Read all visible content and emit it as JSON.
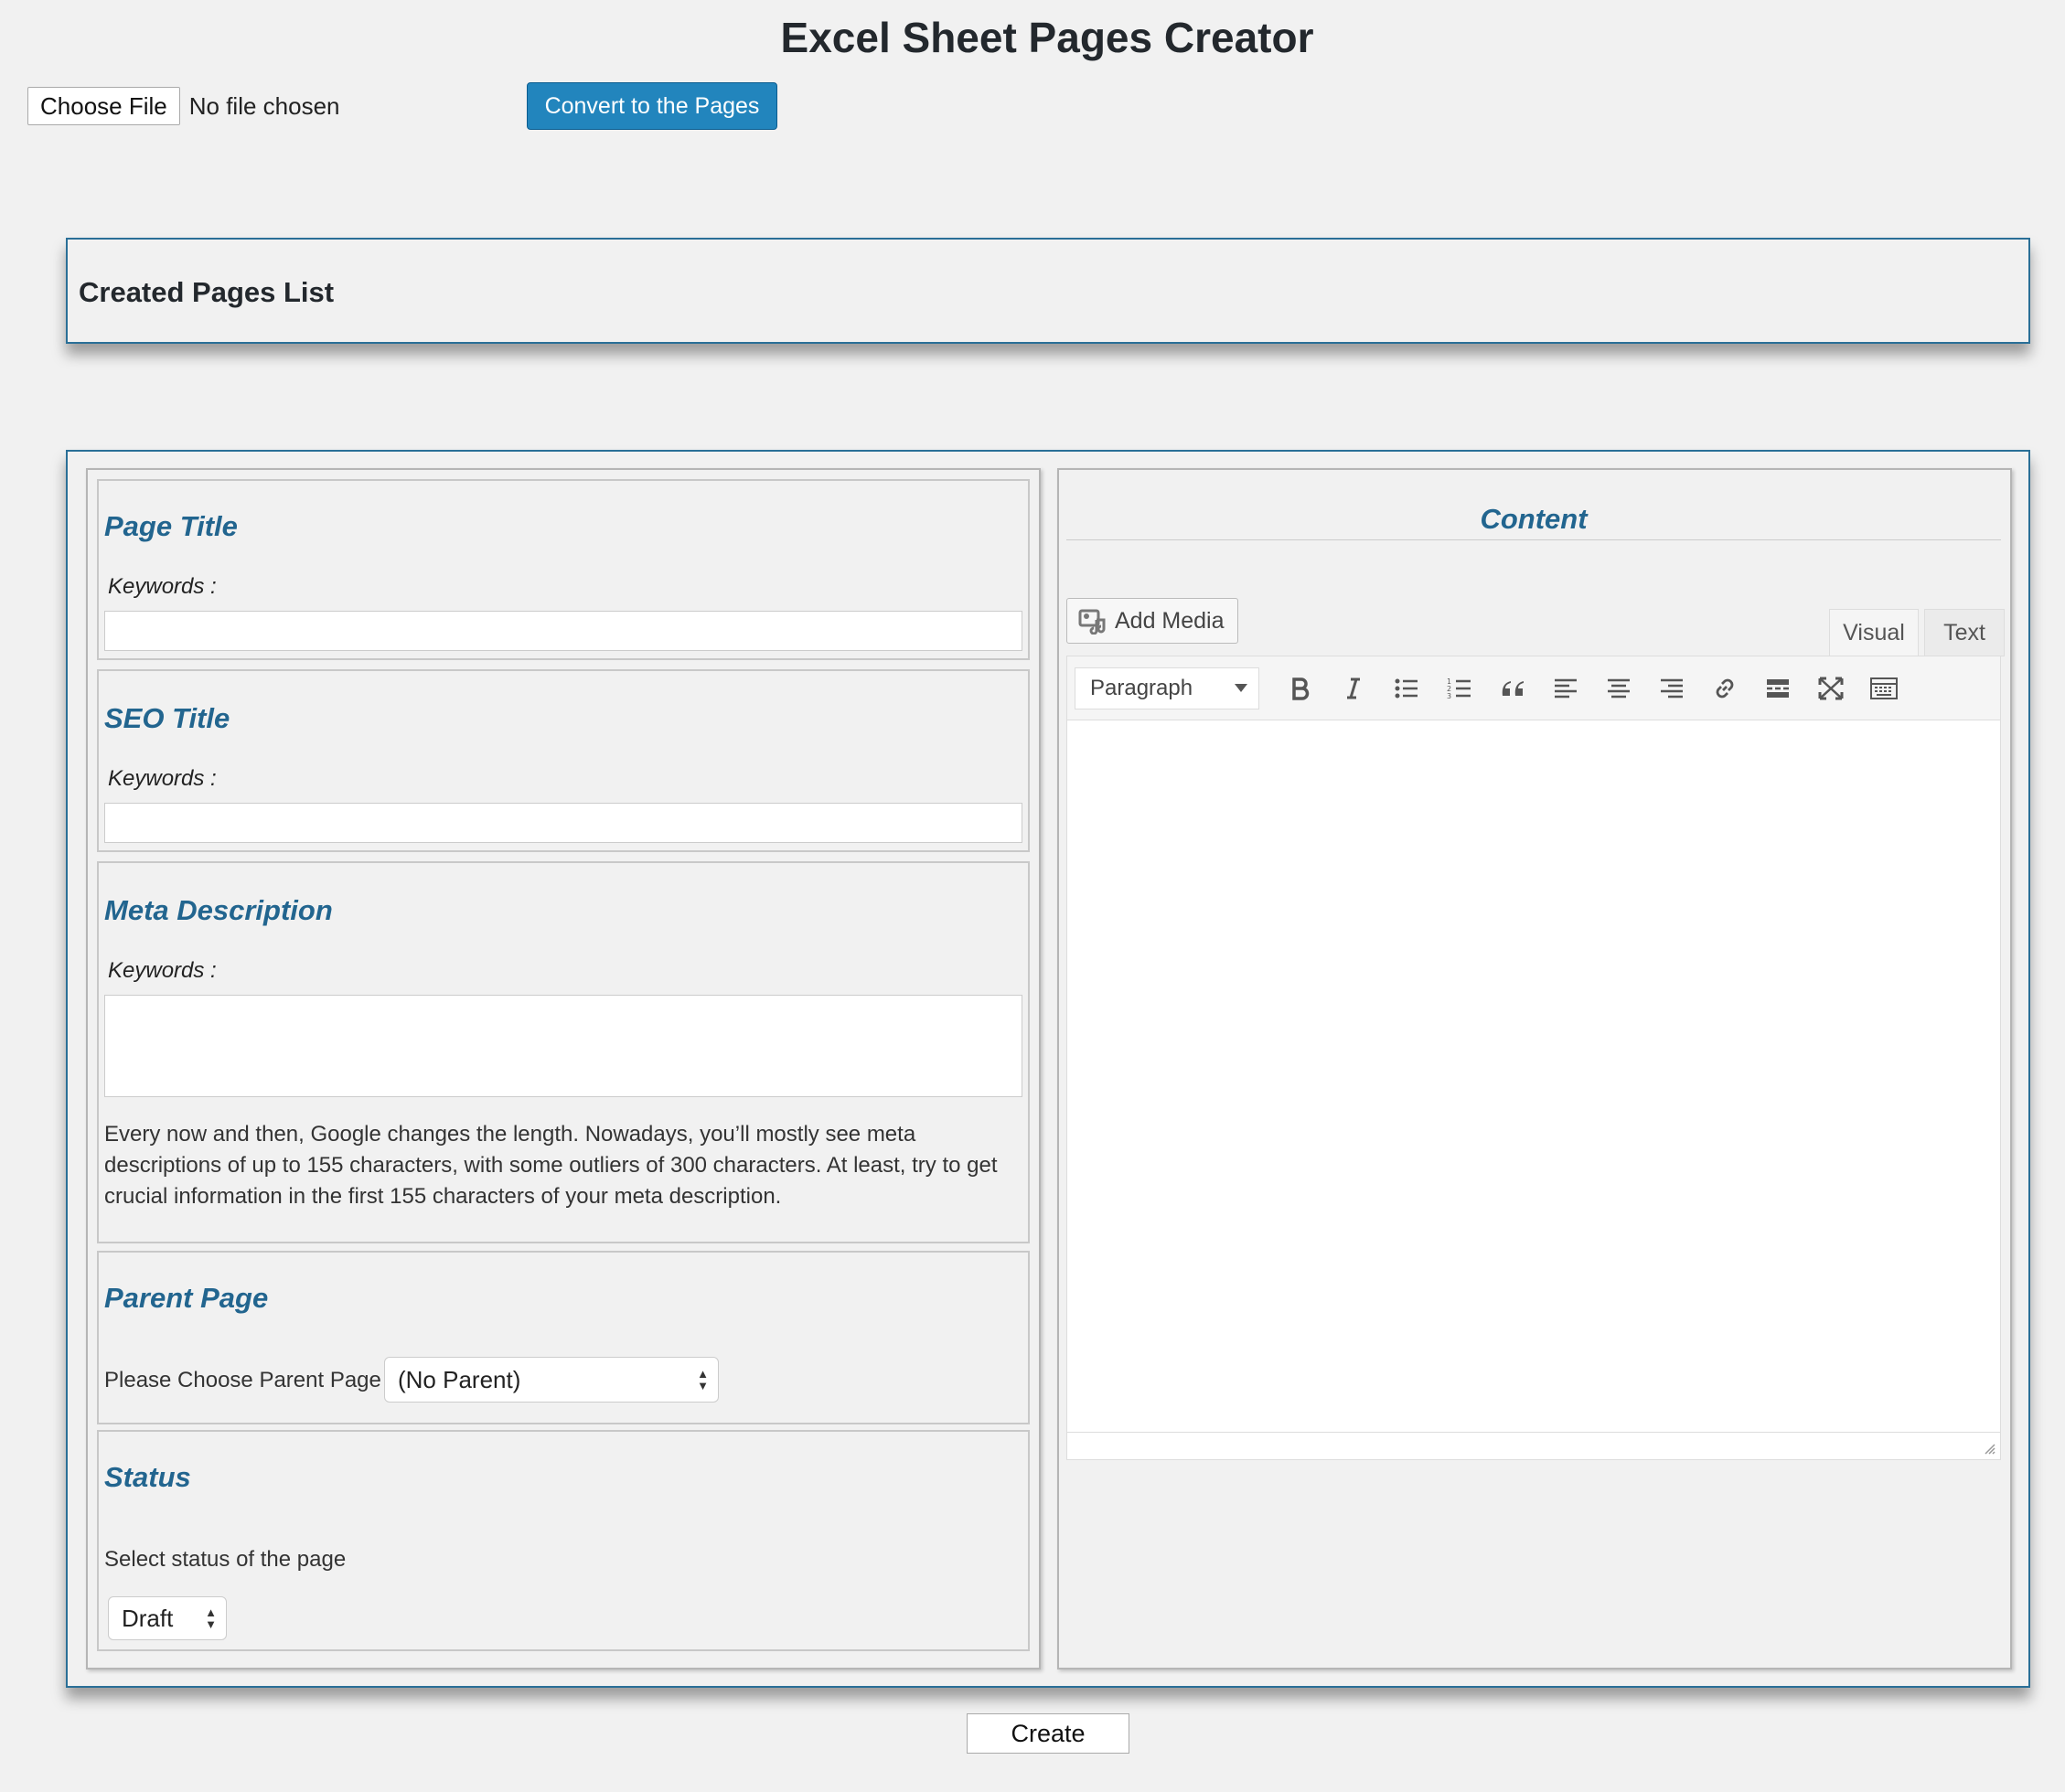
{
  "header": {
    "title": "Excel Sheet Pages Creator"
  },
  "file_upload": {
    "button_label": "Choose File",
    "status": "No file chosen"
  },
  "convert_button": "Convert to the Pages",
  "created_list": {
    "title": "Created Pages List"
  },
  "form": {
    "page_title": {
      "heading": "Page Title",
      "keywords_label": "Keywords :",
      "value": ""
    },
    "seo_title": {
      "heading": "SEO Title",
      "keywords_label": "Keywords :",
      "value": ""
    },
    "meta_description": {
      "heading": "Meta Description",
      "keywords_label": "Keywords :",
      "value": "",
      "help_text": "Every now and then, Google changes the length. Nowadays, you’ll mostly see meta descriptions of up to 155 characters, with some outliers of 300 characters. At least, try to get crucial information in the first 155 characters of your meta description."
    },
    "parent_page": {
      "heading": "Parent Page",
      "label": "Please Choose Parent Page",
      "selected": "(No Parent)"
    },
    "status": {
      "heading": "Status",
      "label": "Select status of the page",
      "selected": "Draft"
    }
  },
  "content": {
    "heading": "Content",
    "add_media_label": "Add Media",
    "tabs": [
      "Visual",
      "Text"
    ],
    "active_tab": "Visual",
    "format_select": "Paragraph",
    "toolbar_icons": [
      "bold-icon",
      "italic-icon",
      "bullet-list-icon",
      "numbered-list-icon",
      "blockquote-icon",
      "align-left-icon",
      "align-center-icon",
      "align-right-icon",
      "link-icon",
      "read-more-icon",
      "fullscreen-icon",
      "toolbar-toggle-icon"
    ],
    "body": ""
  },
  "create_button": "Create",
  "colors": {
    "accent": "#2285bd",
    "panel_border": "#2a6f97",
    "heading": "#22658f",
    "background": "#f1f1f1"
  }
}
